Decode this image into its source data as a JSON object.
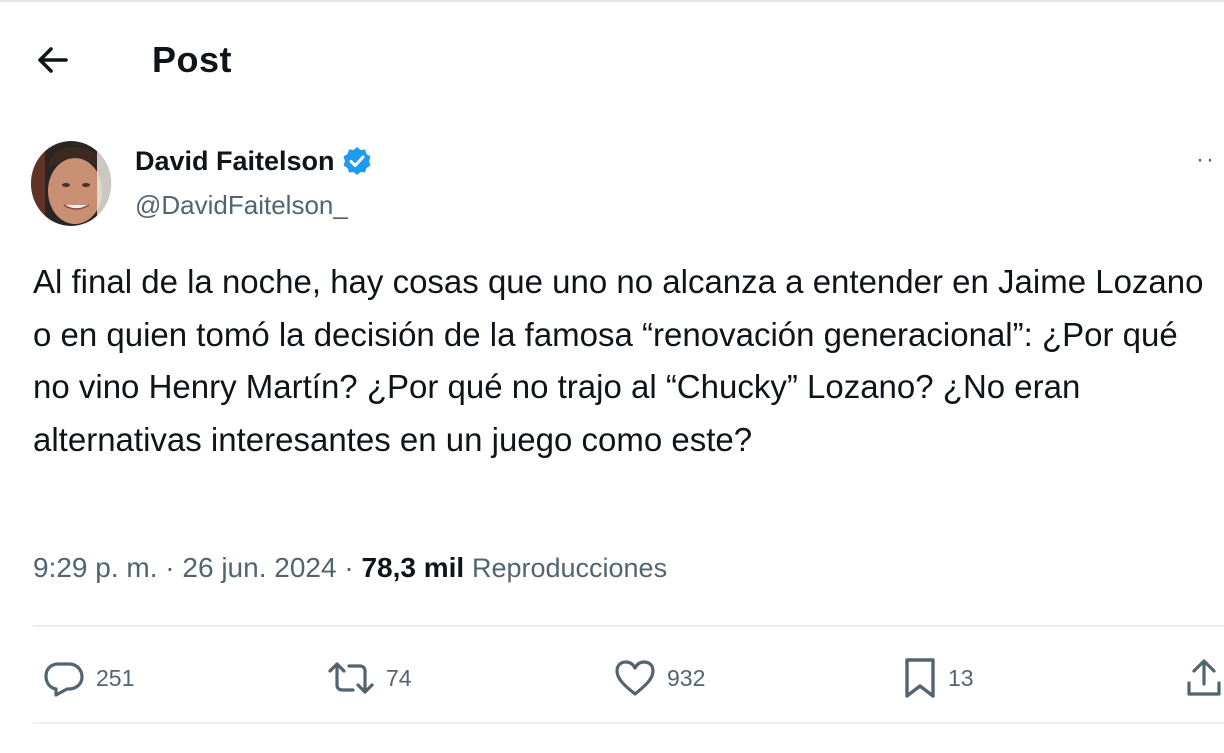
{
  "header": {
    "title": "Post"
  },
  "author": {
    "name": "David Faitelson",
    "handle": "@DavidFaitelson_",
    "verified": true
  },
  "post": {
    "text": "Al final de la noche, hay cosas que uno no alcanza a entender en Jaime Lozano o en quien tomó la decisión de la famosa “renovación generacional”: ¿Por qué no vino Henry Martín? ¿Por qué no trajo al “Chucky” Lozano? ¿No eran alternativas interesantes en un juego como este?",
    "time": "9:29 p. m.",
    "date": "26 jun. 2024",
    "views_count": "78,3 mil",
    "views_label": "Reproducciones"
  },
  "actions": {
    "replies": "251",
    "reposts": "74",
    "likes": "932",
    "bookmarks": "13"
  },
  "icons": {
    "back": "arrow-left-icon",
    "verified": "verified-badge-icon",
    "more": "more-icon",
    "reply": "reply-icon",
    "repost": "repost-icon",
    "like": "heart-icon",
    "bookmark": "bookmark-icon",
    "share": "share-icon"
  },
  "colors": {
    "verified": "#1d9bf0",
    "text": "#0f1419",
    "secondary": "#536471"
  }
}
